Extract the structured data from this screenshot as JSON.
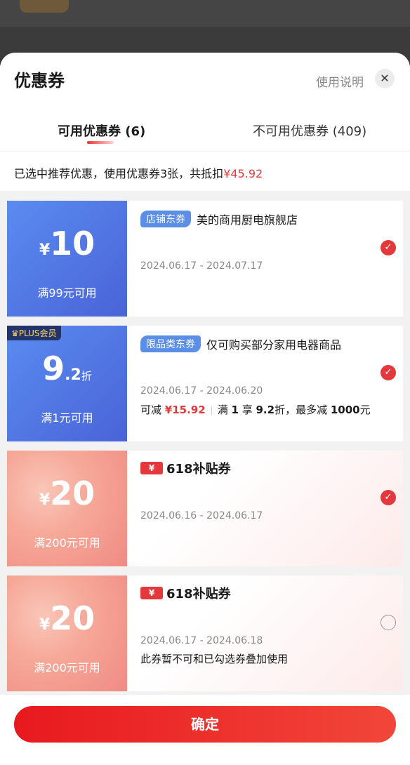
{
  "sheet": {
    "title": "优惠券",
    "help_link": "使用说明",
    "close_icon": "close-icon"
  },
  "tabs": [
    {
      "label": "可用优惠券 (6)",
      "active": true
    },
    {
      "label": "不可用优惠券 (409)",
      "active": false
    }
  ],
  "summary": {
    "text": "已选中推荐优惠，使用优惠券3张，共抵扣",
    "amount": "¥45.92"
  },
  "coupons": [
    {
      "currency": "¥",
      "value": "10",
      "condition": "满99元可用",
      "tag": "店铺东券",
      "scope": "美的商用厨电旗舰店",
      "date_range": "2024.06.17 - 2024.07.17",
      "selected": true
    },
    {
      "plus_badge": "PLUS会员",
      "value_int": "9",
      "value_dec": ".2",
      "unit": "折",
      "condition": "满1元可用",
      "tag": "限品类东券",
      "scope": "仅可购买部分家用电器商品",
      "date_range": "2024.06.17 - 2024.06.20",
      "note_prefix": "可减",
      "note_saving": "¥15.92",
      "note_rule_1": "满",
      "note_rule_2": "1",
      "note_rule_3": "享",
      "note_rule_4": "9.2",
      "note_rule_5": "折，最多减",
      "note_rule_6": "1000",
      "note_rule_7": "元",
      "selected": true
    },
    {
      "currency": "¥",
      "value": "20",
      "condition": "满200元可用",
      "badge_yen": "¥",
      "badge_text": "618补贴券",
      "date_range": "2024.06.16 - 2024.06.17",
      "selected": true
    },
    {
      "currency": "¥",
      "value": "20",
      "condition": "满200元可用",
      "badge_yen": "¥",
      "badge_text": "618补贴券",
      "date_range": "2024.06.17 - 2024.06.18",
      "note": "此券暂不可和已勾选券叠加使用",
      "selected": false
    }
  ],
  "footer": {
    "confirm_label": "确定"
  },
  "colors": {
    "accent": "#e4393c",
    "coupon_blue": "#4a63d8",
    "coupon_pink": "#f6a898"
  }
}
